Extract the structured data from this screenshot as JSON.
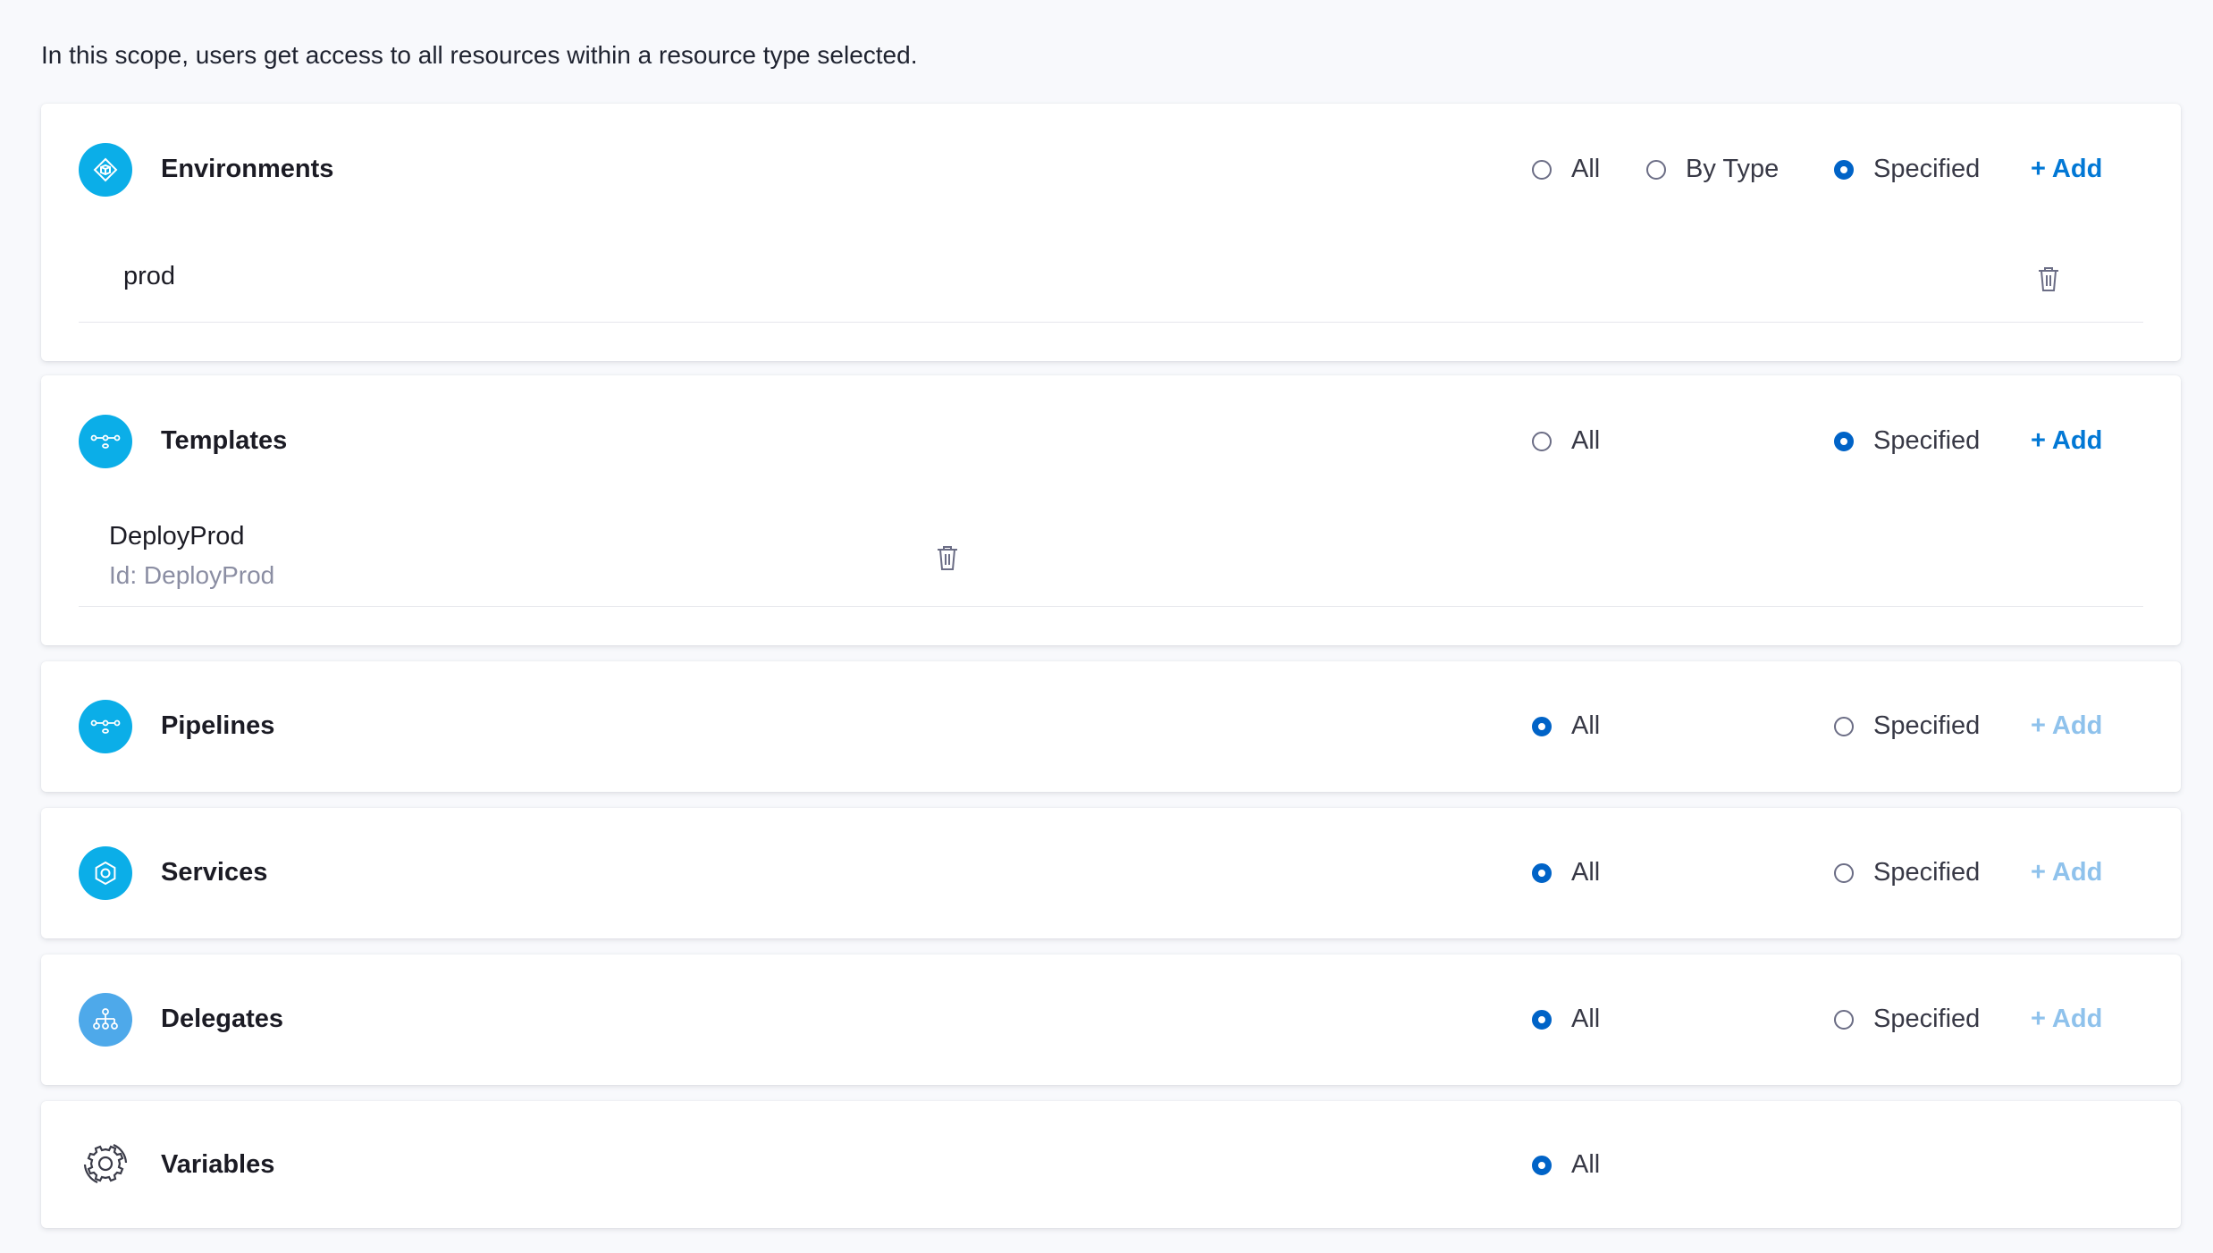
{
  "intro_text": "In this scope, users get access to all resources within a resource type selected.",
  "colors": {
    "accent": "#0278d5",
    "radio_selected": "#0063c7",
    "icon_bg": "#0baee8",
    "icon_bg_light": "#4ea9ea",
    "add_disabled": "#8fc2ec"
  },
  "radio_labels": {
    "all": "All",
    "by_type": "By Type",
    "specified": "Specified"
  },
  "add_label": "+ Add",
  "sections": {
    "environments": {
      "title": "Environments",
      "icon": "environment-icon",
      "selected": "Specified",
      "items": [
        {
          "name": "prod"
        }
      ]
    },
    "templates": {
      "title": "Templates",
      "icon": "template-icon",
      "selected": "Specified",
      "items": [
        {
          "name": "DeployProd",
          "id": "Id: DeployProd"
        }
      ]
    },
    "pipelines": {
      "title": "Pipelines",
      "icon": "pipeline-icon",
      "selected": "All"
    },
    "services": {
      "title": "Services",
      "icon": "service-icon",
      "selected": "All"
    },
    "delegates": {
      "title": "Delegates",
      "icon": "delegate-icon",
      "selected": "All"
    },
    "variables": {
      "title": "Variables",
      "icon": "variables-gear-icon",
      "selected": "All"
    }
  }
}
